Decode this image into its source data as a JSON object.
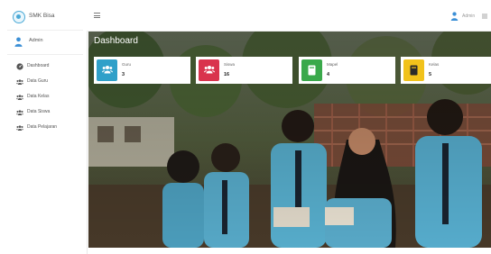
{
  "brand": {
    "name": "SMK Bisa"
  },
  "sidebar": {
    "user_name": "Admin",
    "menu": [
      {
        "label": "Dashboard",
        "icon": "dashboard-icon"
      },
      {
        "label": "Data Guru",
        "icon": "users-icon"
      },
      {
        "label": "Data Kelas",
        "icon": "users-icon"
      },
      {
        "label": "Data Siswa",
        "icon": "users-icon"
      },
      {
        "label": "Data Pelajaran",
        "icon": "users-icon"
      }
    ]
  },
  "topbar": {
    "menu_icon": "hamburger-icon",
    "user_name": "Admin"
  },
  "main": {
    "title": "Dashboard"
  },
  "cards": [
    {
      "label": "Guru",
      "value": "3",
      "color": "#2fa0c9",
      "icon": "users-icon"
    },
    {
      "label": "Siswa",
      "value": "16",
      "color": "#d9334d",
      "icon": "users-icon"
    },
    {
      "label": "Mapel",
      "value": "4",
      "color": "#3aa94b",
      "icon": "book-icon"
    },
    {
      "label": "Kelas",
      "value": "5",
      "color": "#f1c21b",
      "icon": "book-icon"
    }
  ]
}
